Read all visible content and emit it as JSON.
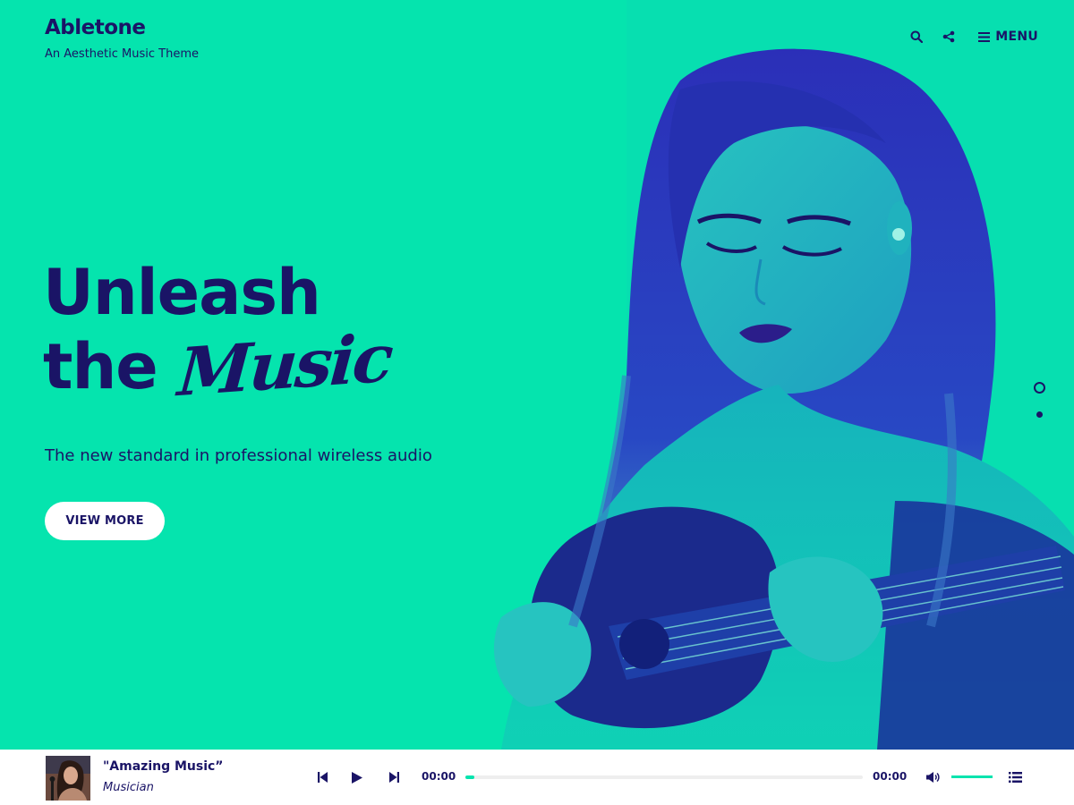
{
  "brand": {
    "title": "Abletone",
    "tagline": "An Aesthetic Music Theme"
  },
  "header": {
    "menu_label": "MENU",
    "icons": [
      "search-icon",
      "share-icon",
      "menu-icon"
    ]
  },
  "hero": {
    "headline_line1": "Unleash",
    "headline_the": "the",
    "headline_script": "Music",
    "subtitle": "The new standard in professional wireless audio",
    "cta_label": "VIEW MORE",
    "slide_count": 2,
    "active_slide": 1
  },
  "player": {
    "track_title": "\"Amazing Music”",
    "artist": "Musician",
    "current_time": "00:00",
    "total_time": "00:00",
    "progress": 0,
    "volume": 1.0
  },
  "colors": {
    "accent": "#05e4ae",
    "ink": "#1a1466",
    "player_bg": "#ffffff"
  }
}
